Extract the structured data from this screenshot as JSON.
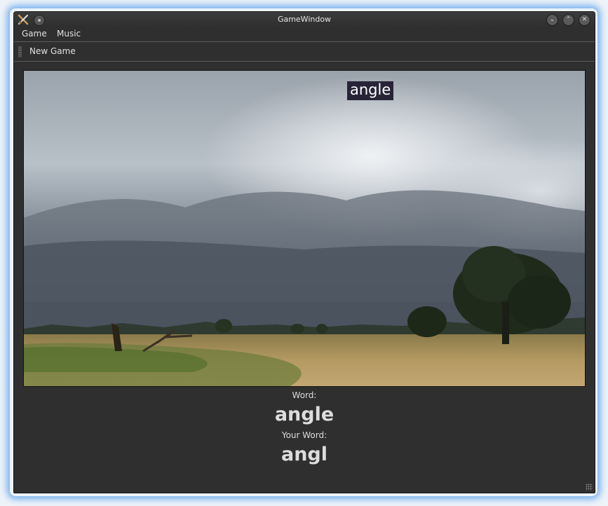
{
  "window": {
    "title": "GameWindow"
  },
  "menu": {
    "items": [
      {
        "label": "Game"
      },
      {
        "label": "Music"
      }
    ]
  },
  "toolbar": {
    "new_game_label": "New Game"
  },
  "game": {
    "floating_word": "angle",
    "word_label": "Word:",
    "word": "angle",
    "your_word_label": "Your Word:",
    "your_word": "angl"
  },
  "icons": {
    "app": "app-icon",
    "window_menu": "window-menu-icon",
    "minimize": "minimize-icon",
    "maximize": "maximize-icon",
    "close": "close-icon"
  },
  "colors": {
    "window_bg": "#2f2f2f",
    "glow": "#4696eb",
    "text": "#e0e0e0"
  }
}
